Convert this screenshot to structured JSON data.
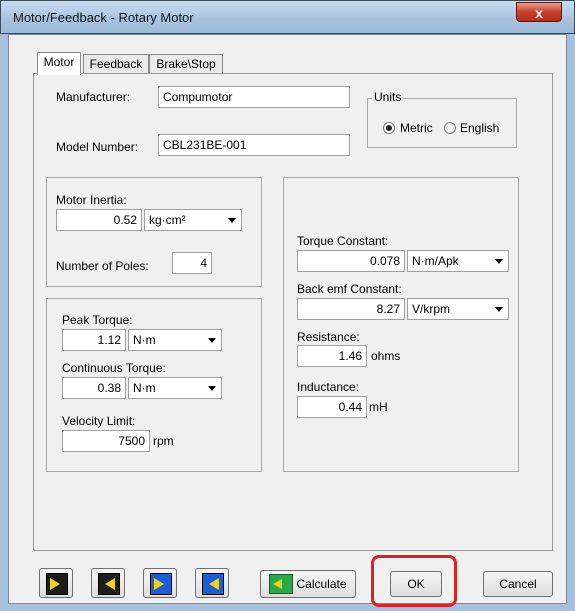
{
  "window": {
    "title": "Motor/Feedback - Rotary Motor",
    "close_label": "x"
  },
  "tabs": [
    {
      "label": "Motor",
      "active": true
    },
    {
      "label": "Feedback",
      "active": false
    },
    {
      "label": "Brake\\Stop",
      "active": false
    }
  ],
  "motor": {
    "manufacturer_label": "Manufacturer:",
    "manufacturer_value": "Compumotor",
    "model_label": "Model Number:",
    "model_value": "CBL231BE-001",
    "units": {
      "group_label": "Units",
      "metric_label": "Metric",
      "english_label": "English",
      "selected": "Metric"
    },
    "inertia_label": "Motor Inertia:",
    "inertia_value": "0.52",
    "inertia_unit": "kg·cm²",
    "poles_label": "Number of Poles:",
    "poles_value": "4",
    "peak_torque_label": "Peak Torque:",
    "peak_torque_value": "1.12",
    "peak_torque_unit": "N·m",
    "cont_torque_label": "Continuous Torque:",
    "cont_torque_value": "0.38",
    "cont_torque_unit": "N·m",
    "velocity_label": "Velocity Limit:",
    "velocity_value": "7500",
    "velocity_unit": "rpm",
    "torque_const_label": "Torque Constant:",
    "torque_const_value": "0.078",
    "torque_const_unit": "N·m/Apk",
    "bemf_label": "Back emf Constant:",
    "bemf_value": "8.27",
    "bemf_unit": "V/krpm",
    "resistance_label": "Resistance:",
    "resistance_value": "1.46",
    "resistance_unit": "ohms",
    "inductance_label": "Inductance:",
    "inductance_value": "0.44",
    "inductance_unit": "mH"
  },
  "buttons": {
    "calculate_label": "Calculate",
    "ok_label": "OK",
    "cancel_label": "Cancel"
  },
  "colors": {
    "highlight": "#e0211f",
    "icon_arrow": "#f2d21a",
    "icon_arrow_blue": "#1b5fd6",
    "calc_green": "#2aa84a"
  }
}
